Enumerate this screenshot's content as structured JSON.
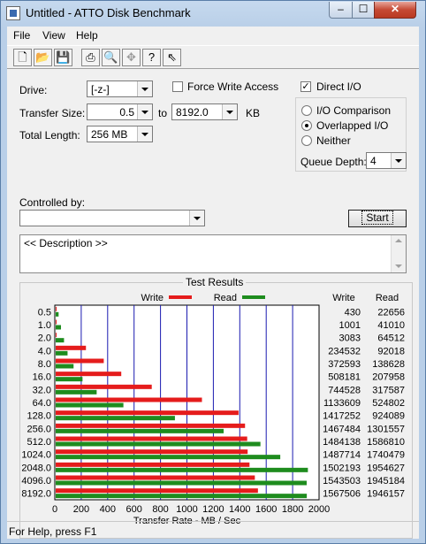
{
  "window": {
    "title": "Untitled - ATTO Disk Benchmark",
    "minimize": "–",
    "maximize": "☐",
    "close": "✕"
  },
  "menu": {
    "items": [
      "File",
      "View",
      "Help"
    ]
  },
  "toolbar": {
    "icons": [
      "new-icon",
      "open-icon",
      "save-icon",
      "print-icon",
      "print-preview-icon",
      "move-icon",
      "help-icon",
      "context-help-icon"
    ]
  },
  "form": {
    "drive_label": "Drive:",
    "drive_value": "[-z-]",
    "force_write_label": "Force Write Access",
    "force_write_checked": false,
    "direct_io_label": "Direct I/O",
    "direct_io_checked": true,
    "transfer_size_label": "Transfer Size:",
    "transfer_from": "0.5",
    "to_label": "to",
    "transfer_to": "8192.0",
    "kb_label": "KB",
    "total_length_label": "Total Length:",
    "total_length_value": "256 MB",
    "io_comparison_label": "I/O Comparison",
    "overlapped_io_label": "Overlapped I/O",
    "neither_label": "Neither",
    "selected_mode": "Overlapped I/O",
    "queue_depth_label": "Queue Depth:",
    "queue_depth_value": "4",
    "controlled_by_label": "Controlled by:",
    "controlled_by_value": "",
    "start_label": "Start",
    "description": "<< Description >>"
  },
  "status": {
    "text": "For Help, press F1"
  },
  "chart_data": {
    "type": "bar",
    "title": "Test Results",
    "xlabel": "Transfer Rate - MB / Sec",
    "xlim": [
      0,
      2000
    ],
    "xticks": [
      "0",
      "200",
      "400",
      "600",
      "800",
      "1000",
      "1200",
      "1400",
      "1600",
      "1800",
      "2000"
    ],
    "categories": [
      "0.5",
      "1.0",
      "2.0",
      "4.0",
      "8.0",
      "16.0",
      "32.0",
      "64.0",
      "128.0",
      "256.0",
      "512.0",
      "1024.0",
      "2048.0",
      "4096.0",
      "8192.0"
    ],
    "series": [
      {
        "name": "Write",
        "color": "#e51c1c",
        "values": [
          430,
          1001,
          3083,
          234532,
          372593,
          508181,
          744528,
          1133609,
          1417252,
          1467484,
          1484138,
          1487714,
          1502193,
          1543503,
          1567506
        ]
      },
      {
        "name": "Read",
        "color": "#1e8c1e",
        "values": [
          22656,
          41010,
          64512,
          92018,
          138628,
          207958,
          317587,
          524802,
          924089,
          1301557,
          1586810,
          1740479,
          1954627,
          1945184,
          1946157
        ]
      }
    ],
    "value_unit_divisor": 1024,
    "grid": "vertical",
    "legend": "top",
    "column_headers": [
      "Write",
      "Read"
    ]
  }
}
